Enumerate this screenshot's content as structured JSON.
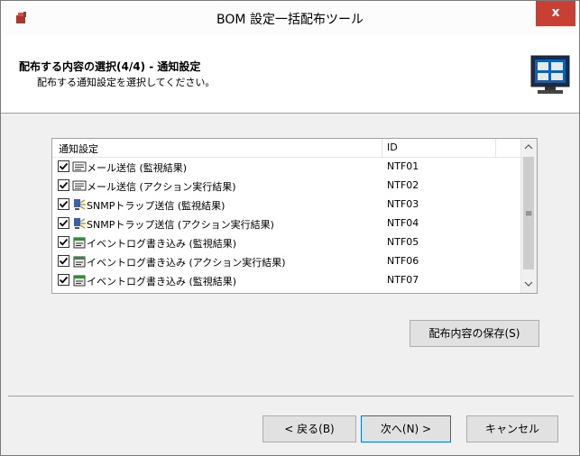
{
  "window": {
    "title": "BOM 設定一括配布ツール",
    "close_label": "x"
  },
  "header": {
    "title": "配布する内容の選択(4/4) - 通知設定",
    "subtitle": "配布する通知設定を選択してください。"
  },
  "list": {
    "columns": [
      "通知設定",
      "ID"
    ],
    "rows": [
      {
        "label": "メール送信 (監視結果)",
        "id": "NTF01",
        "icon": "mail-icon",
        "checked": true
      },
      {
        "label": "メール送信 (アクション実行結果)",
        "id": "NTF02",
        "icon": "mail-icon",
        "checked": true
      },
      {
        "label": "SNMPトラップ送信 (監視結果)",
        "id": "NTF03",
        "icon": "snmp-trap-icon",
        "checked": true
      },
      {
        "label": "SNMPトラップ送信 (アクション実行結果)",
        "id": "NTF04",
        "icon": "snmp-trap-icon",
        "checked": true
      },
      {
        "label": "イベントログ書き込み (監視結果)",
        "id": "NTF05",
        "icon": "event-log-icon",
        "checked": true
      },
      {
        "label": "イベントログ書き込み (アクション実行結果)",
        "id": "NTF06",
        "icon": "event-log-icon",
        "checked": true
      },
      {
        "label": "イベントログ書き込み (監視結果)",
        "id": "NTF07",
        "icon": "event-log-icon",
        "checked": true
      }
    ],
    "scroll_grip": "≡"
  },
  "buttons": {
    "save": "配布内容の保存(S)",
    "back": "< 戻る(B)",
    "next": "次へ(N) >",
    "cancel": "キャンセル"
  },
  "colors": {
    "close_button": "#c84031",
    "default_button_border": "#0078d7",
    "header_background": "#ffffff",
    "window_background": "#f0f0f0"
  }
}
